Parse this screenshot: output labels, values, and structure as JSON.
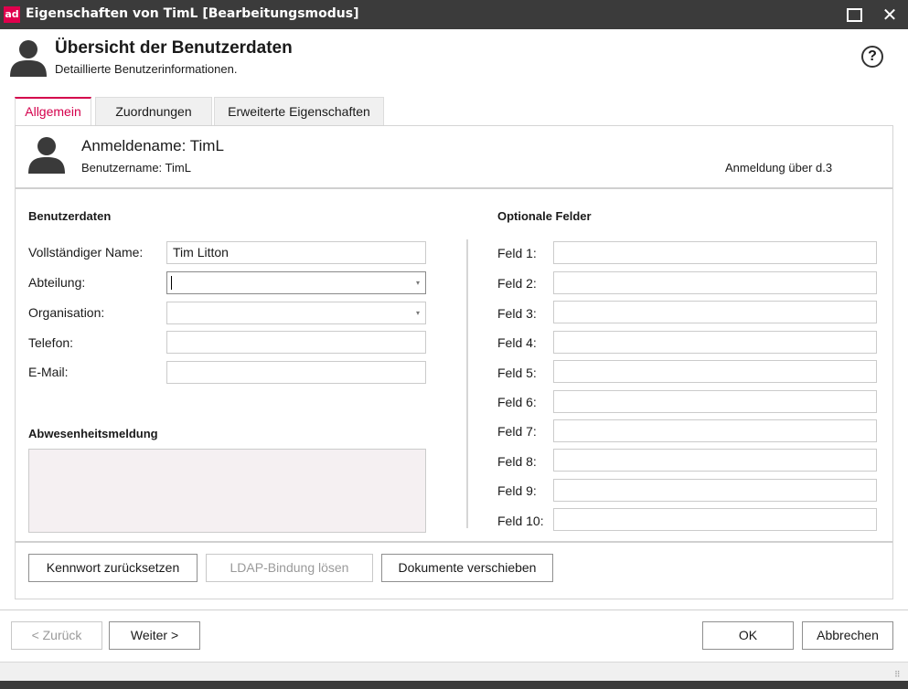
{
  "window": {
    "logo": "ad",
    "title": "Eigenschaften von TimL [Bearbeitungsmodus]"
  },
  "header": {
    "title": "Übersicht der Benutzerdaten",
    "subtitle": "Detaillierte Benutzerinformationen.",
    "help": "?"
  },
  "tabs": [
    {
      "label": "Allgemein",
      "active": true
    },
    {
      "label": "Zuordnungen",
      "active": false
    },
    {
      "label": "Erweiterte Eigenschaften",
      "active": false
    }
  ],
  "user": {
    "login_name": "Anmeldename: TimL",
    "username": "Benutzername: TimL",
    "login_via": "Anmeldung über d.3"
  },
  "user_data": {
    "heading": "Benutzerdaten",
    "fields": [
      {
        "label": "Vollständiger Name:",
        "value": "Tim Litton",
        "type": "text"
      },
      {
        "label": "Abteilung:",
        "value": "",
        "type": "dropdown"
      },
      {
        "label": "Organisation:",
        "value": "",
        "type": "dropdown"
      },
      {
        "label": "Telefon:",
        "value": "",
        "type": "text"
      },
      {
        "label": "E-Mail:",
        "value": "",
        "type": "text"
      }
    ]
  },
  "absence": {
    "heading": "Abwesenheitsmeldung",
    "value": ""
  },
  "optional": {
    "heading": "Optionale Felder",
    "fields": [
      {
        "label": "Feld 1:",
        "value": ""
      },
      {
        "label": "Feld 2:",
        "value": ""
      },
      {
        "label": "Feld 3:",
        "value": ""
      },
      {
        "label": "Feld 4:",
        "value": ""
      },
      {
        "label": "Feld 5:",
        "value": ""
      },
      {
        "label": "Feld 6:",
        "value": ""
      },
      {
        "label": "Feld 7:",
        "value": ""
      },
      {
        "label": "Feld 8:",
        "value": ""
      },
      {
        "label": "Feld 9:",
        "value": ""
      },
      {
        "label": "Feld 10:",
        "value": ""
      }
    ]
  },
  "actions": {
    "reset_password": "Kennwort zurücksetzen",
    "unbind_ldap": "LDAP-Bindung lösen",
    "move_documents": "Dokumente verschieben"
  },
  "footer": {
    "back": "< Zurück",
    "next": "Weiter >",
    "ok": "OK",
    "cancel": "Abbrechen"
  },
  "icons": {
    "dropdown_arrow": "▾",
    "maximize": "maximize-icon",
    "close": "✕",
    "grip": "⠿"
  },
  "colors": {
    "accent": "#d4004c",
    "titlebar": "#3b3b3b"
  }
}
